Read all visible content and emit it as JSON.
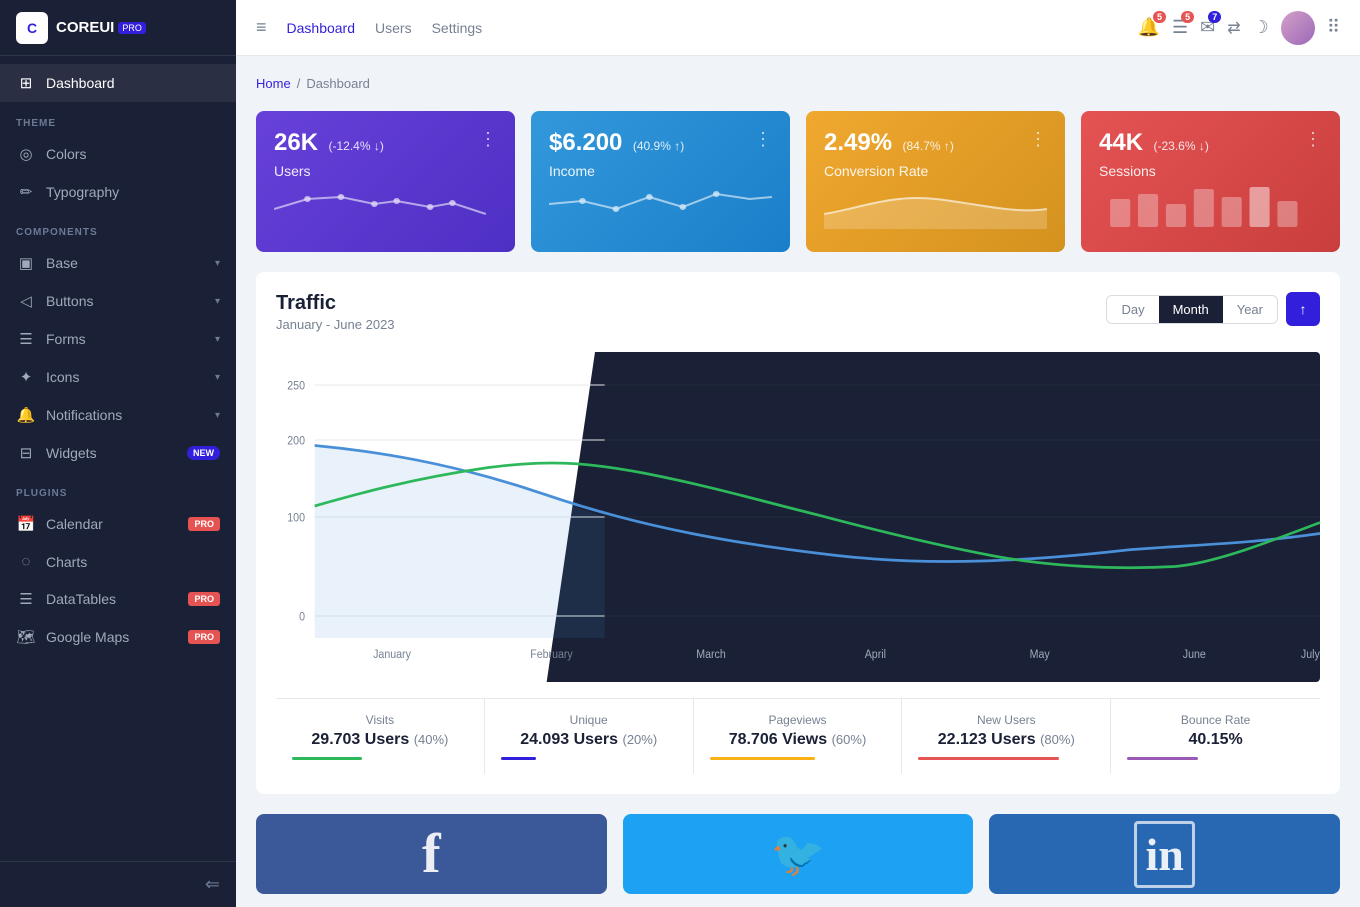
{
  "sidebar": {
    "logo": {
      "text": "COREUI",
      "pro_badge": "PRO"
    },
    "nav_items": [
      {
        "id": "dashboard",
        "label": "Dashboard",
        "icon": "⊞",
        "active": true,
        "badge": null
      },
      {
        "id": "colors",
        "section": "THEME",
        "label": "Colors",
        "icon": "◎",
        "active": false,
        "badge": null
      },
      {
        "id": "typography",
        "label": "Typography",
        "icon": "✏",
        "active": false,
        "badge": null
      },
      {
        "id": "components_label",
        "section": "COMPONENTS",
        "label": null
      },
      {
        "id": "base",
        "label": "Base",
        "icon": "▣",
        "active": false,
        "badge": null,
        "arrow": true
      },
      {
        "id": "buttons",
        "label": "Buttons",
        "icon": "◁",
        "active": false,
        "badge": null,
        "arrow": true
      },
      {
        "id": "forms",
        "label": "Forms",
        "icon": "☰",
        "active": false,
        "badge": null,
        "arrow": true
      },
      {
        "id": "icons",
        "label": "Icons",
        "icon": "✦",
        "active": false,
        "badge": null,
        "arrow": true
      },
      {
        "id": "notifications",
        "label": "Notifications",
        "icon": "🔔",
        "active": false,
        "badge": null,
        "arrow": true
      },
      {
        "id": "widgets",
        "label": "Widgets",
        "icon": "⊟",
        "active": false,
        "badge": "NEW",
        "badge_type": "new"
      },
      {
        "id": "plugins_label",
        "section": "PLUGINS",
        "label": null
      },
      {
        "id": "calendar",
        "label": "Calendar",
        "icon": "📅",
        "active": false,
        "badge": "PRO",
        "badge_type": "pro"
      },
      {
        "id": "charts",
        "label": "Charts",
        "icon": "◌",
        "active": false,
        "badge": null
      },
      {
        "id": "datatables",
        "label": "DataTables",
        "icon": "☰",
        "active": false,
        "badge": "PRO",
        "badge_type": "pro"
      },
      {
        "id": "googlemaps",
        "label": "Google Maps",
        "icon": "🗺",
        "active": false,
        "badge": "PRO",
        "badge_type": "pro"
      }
    ],
    "footer_icon": "⇐"
  },
  "header": {
    "hamburger": "≡",
    "nav": [
      {
        "label": "Dashboard",
        "active": true
      },
      {
        "label": "Users",
        "active": false
      },
      {
        "label": "Settings",
        "active": false
      }
    ],
    "icons": [
      {
        "id": "bell",
        "symbol": "🔔",
        "badge": "5",
        "badge_color": "red"
      },
      {
        "id": "list",
        "symbol": "☰",
        "badge": "5",
        "badge_color": "red"
      },
      {
        "id": "email",
        "symbol": "✉",
        "badge": "7",
        "badge_color": "blue"
      },
      {
        "id": "translate",
        "symbol": "⇄",
        "badge": null
      },
      {
        "id": "moon",
        "symbol": "☾",
        "badge": null
      }
    ]
  },
  "breadcrumb": {
    "home": "Home",
    "separator": "/",
    "current": "Dashboard"
  },
  "stats_cards": [
    {
      "id": "users",
      "value": "26K",
      "change": "(-12.4% ↓)",
      "label": "Users",
      "color": "purple",
      "chart_type": "line"
    },
    {
      "id": "income",
      "value": "$6.200",
      "change": "(40.9% ↑)",
      "label": "Income",
      "color": "blue",
      "chart_type": "line"
    },
    {
      "id": "conversion",
      "value": "2.49%",
      "change": "(84.7% ↑)",
      "label": "Conversion Rate",
      "color": "yellow",
      "chart_type": "area"
    },
    {
      "id": "sessions",
      "value": "44K",
      "change": "(-23.6% ↓)",
      "label": "Sessions",
      "color": "red",
      "chart_type": "bar"
    }
  ],
  "traffic": {
    "title": "Traffic",
    "subtitle": "January - June 2023",
    "time_buttons": [
      "Day",
      "Month",
      "Year"
    ],
    "active_time": "Month",
    "y_labels": [
      "250",
      "200",
      "100",
      "0"
    ],
    "x_labels_light": [
      "January",
      "February"
    ],
    "x_labels_dark": [
      "March",
      "April",
      "May",
      "June",
      "July"
    ],
    "stats": [
      {
        "label": "Visits",
        "value": "29.703 Users",
        "sub": "(40%)",
        "bar_color": "green",
        "bar_width": "40%"
      },
      {
        "label": "Unique",
        "value": "24.093 Users",
        "sub": "(20%)",
        "bar_color": "blue",
        "bar_width": "20%"
      },
      {
        "label": "Pageviews",
        "value": "78.706 Views",
        "sub": "(60%)",
        "bar_color": "yellow",
        "bar_width": "60%"
      },
      {
        "label": "New Users",
        "value": "22.123 Users",
        "sub": "(80%)",
        "bar_color": "red",
        "bar_width": "80%"
      },
      {
        "label": "Bounce Rate",
        "value": "40.15%",
        "sub": "",
        "bar_color": "purple",
        "bar_width": "40%"
      }
    ]
  },
  "social": [
    {
      "id": "facebook",
      "symbol": "f",
      "color": "#3b5998"
    },
    {
      "id": "twitter",
      "symbol": "🐦",
      "color": "#1da1f2"
    },
    {
      "id": "linkedin",
      "symbol": "in",
      "color": "#2867b2"
    }
  ]
}
